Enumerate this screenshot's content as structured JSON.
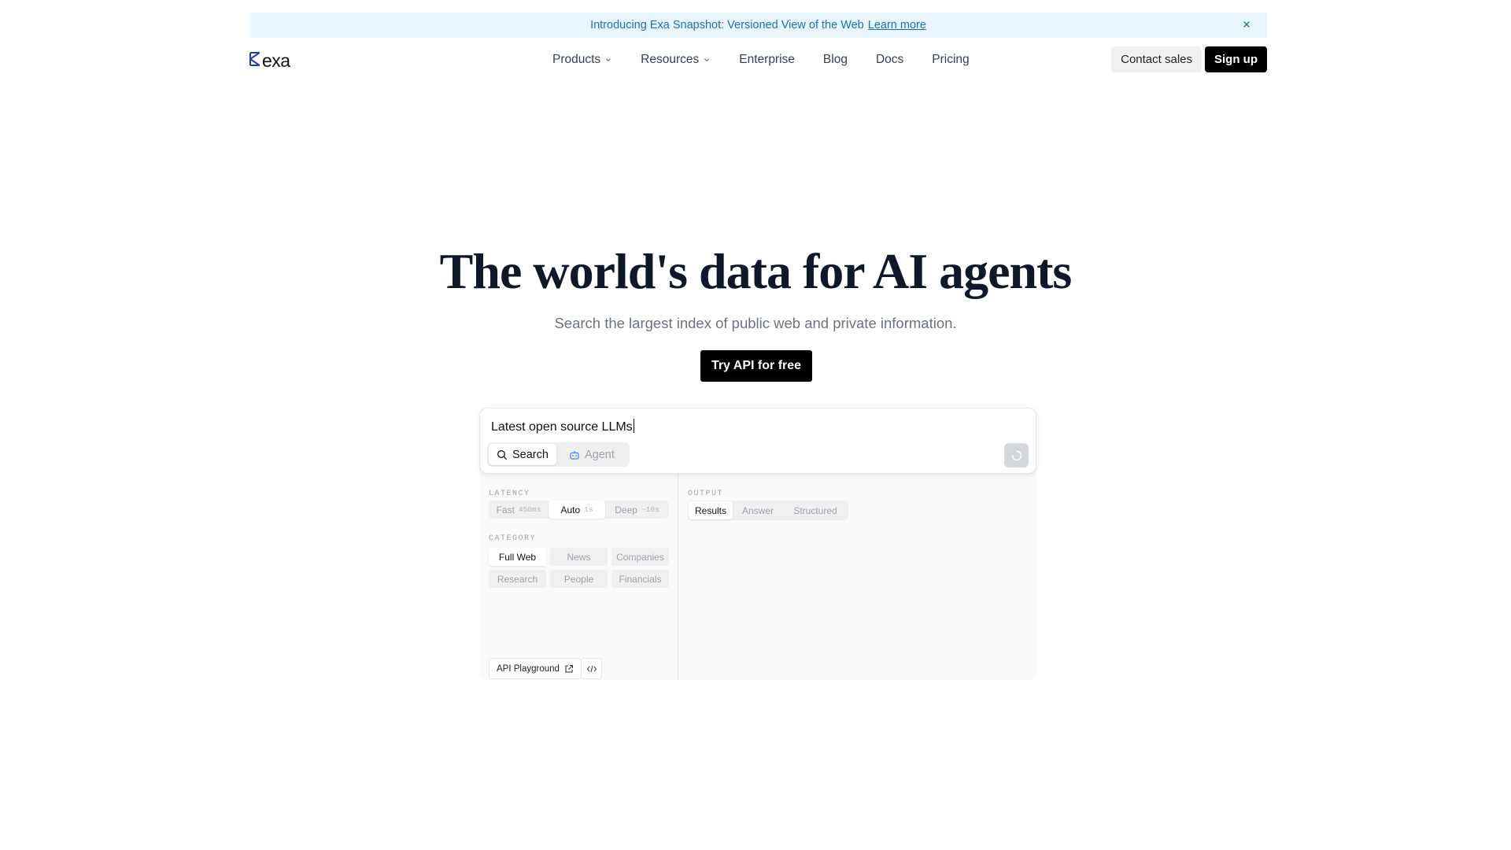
{
  "announcement": {
    "text": "Introducing Exa Snapshot: Versioned View of the Web",
    "link": "Learn more",
    "close_icon": "close-icon"
  },
  "nav": {
    "logo": "exa",
    "items": [
      {
        "label": "Products",
        "has_dropdown": true
      },
      {
        "label": "Resources",
        "has_dropdown": true
      },
      {
        "label": "Enterprise",
        "has_dropdown": false
      },
      {
        "label": "Blog",
        "has_dropdown": false
      },
      {
        "label": "Docs",
        "has_dropdown": false
      },
      {
        "label": "Pricing",
        "has_dropdown": false
      }
    ],
    "contact": "Contact sales",
    "signup": "Sign up"
  },
  "hero": {
    "title": "The world's data for AI agents",
    "subtitle": "Search the largest index of public web and private information.",
    "cta": "Try API for free"
  },
  "demo": {
    "query": "Latest open source LLMs",
    "modes": [
      "Search",
      "Agent"
    ],
    "active_mode": "Search",
    "latency": {
      "label": "LATENCY",
      "options": [
        {
          "label": "Fast",
          "sub": "450ms"
        },
        {
          "label": "Auto",
          "sub": "1s"
        },
        {
          "label": "Deep",
          "sub": "~10s"
        }
      ],
      "selected": "Auto"
    },
    "category": {
      "label": "CATEGORY",
      "options": [
        "Full Web",
        "News",
        "Companies",
        "Research",
        "People",
        "Financials"
      ],
      "selected": "Full Web"
    },
    "output": {
      "label": "OUTPUT",
      "options": [
        "Results",
        "Answer",
        "Structured"
      ],
      "selected": "Results"
    },
    "playground": "API Playground"
  },
  "colors": {
    "announce_bg": "#eaf6fd",
    "announce_text": "#1d6fb8",
    "logo_accent": "#1e40af"
  }
}
